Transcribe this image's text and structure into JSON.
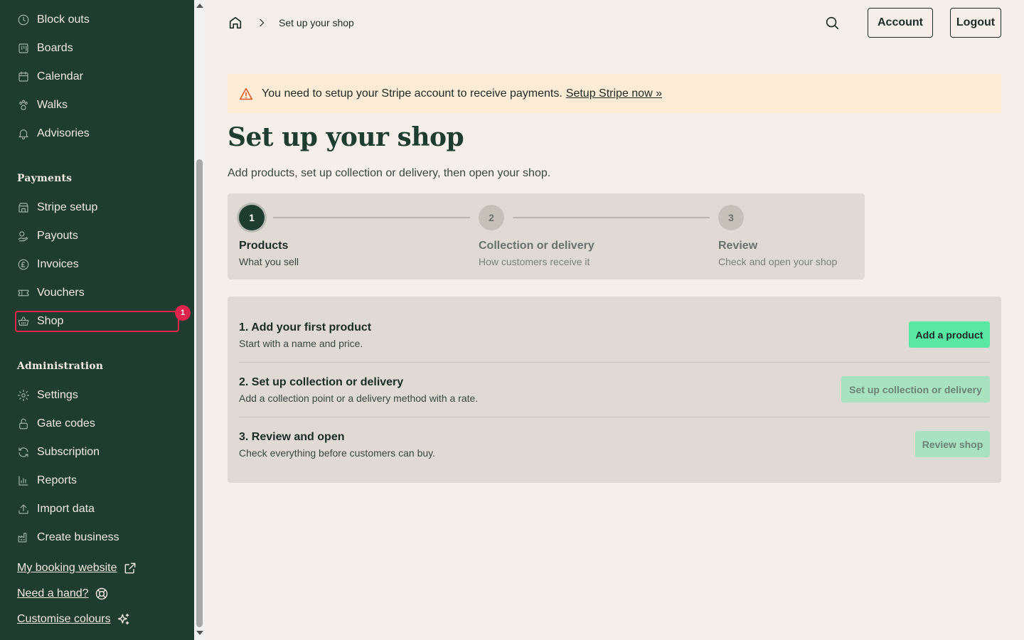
{
  "sidebar": {
    "top_items": [
      {
        "label": "Block outs",
        "icon": "clock-icon"
      },
      {
        "label": "Boards",
        "icon": "board-icon"
      },
      {
        "label": "Calendar",
        "icon": "calendar-icon"
      },
      {
        "label": "Walks",
        "icon": "paw-icon"
      },
      {
        "label": "Advisories",
        "icon": "bell-icon"
      }
    ],
    "payments_title": "Payments",
    "payments_items": [
      {
        "label": "Stripe setup",
        "icon": "store-icon"
      },
      {
        "label": "Payouts",
        "icon": "payouts-icon"
      },
      {
        "label": "Invoices",
        "icon": "pound-icon"
      },
      {
        "label": "Vouchers",
        "icon": "ticket-icon"
      },
      {
        "label": "Shop",
        "icon": "basket-icon",
        "badge": "1"
      }
    ],
    "admin_title": "Administration",
    "admin_items": [
      {
        "label": "Settings",
        "icon": "gear-icon"
      },
      {
        "label": "Gate codes",
        "icon": "lock-icon"
      },
      {
        "label": "Subscription",
        "icon": "refresh-icon"
      },
      {
        "label": "Reports",
        "icon": "chart-icon"
      },
      {
        "label": "Import data",
        "icon": "upload-icon"
      },
      {
        "label": "Create business",
        "icon": "factory-icon"
      }
    ],
    "footer_links": [
      {
        "label": "My booking website",
        "icon": "external-link-icon"
      },
      {
        "label": "Need a hand?",
        "icon": "lifebuoy-icon"
      },
      {
        "label": "Customise colours",
        "icon": "sparkles-icon"
      }
    ]
  },
  "header": {
    "breadcrumb_current": "Set up your shop",
    "account_label": "Account",
    "logout_label": "Logout"
  },
  "alert": {
    "message": "You need to setup your Stripe account to receive payments.",
    "link": "Setup Stripe now »"
  },
  "page": {
    "title": "Set up your shop",
    "subtitle": "Add products, set up collection or delivery, then open your shop."
  },
  "stepper": {
    "steps": [
      {
        "number": "1",
        "title": "Products",
        "subtitle": "What you sell",
        "active": true
      },
      {
        "number": "2",
        "title": "Collection or delivery",
        "subtitle": "How customers receive it",
        "active": false
      },
      {
        "number": "3",
        "title": "Review",
        "subtitle": "Check and open your shop",
        "active": false
      }
    ]
  },
  "tasks": [
    {
      "title": "1. Add your first product",
      "subtitle": "Start with a name and price.",
      "button": "Add a product",
      "enabled": true
    },
    {
      "title": "2. Set up collection or delivery",
      "subtitle": "Add a collection point or a delivery method with a rate.",
      "button": "Set up collection or delivery",
      "enabled": false
    },
    {
      "title": "3. Review and open",
      "subtitle": "Check everything before customers can buy.",
      "button": "Review shop",
      "enabled": false
    }
  ],
  "colors": {
    "sidebar_bg": "#1e3d2f",
    "page_bg": "#f6efe9",
    "accent_green": "#5ae6a3",
    "highlight_red": "#e0244b",
    "alert_bg": "#fdebd6"
  }
}
